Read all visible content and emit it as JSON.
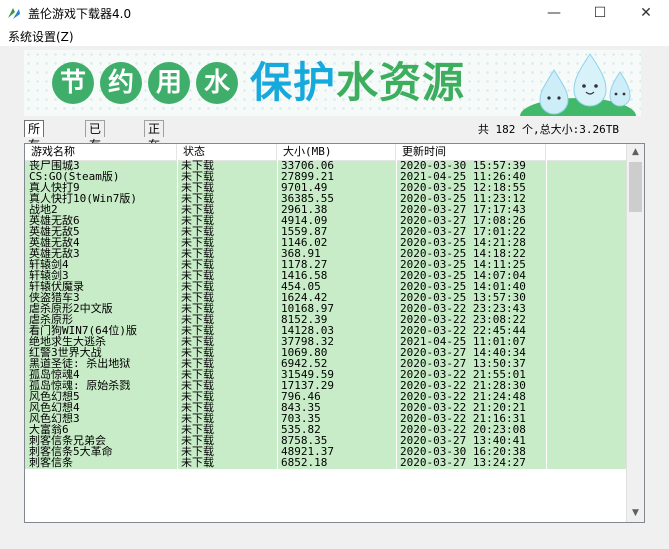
{
  "window": {
    "title": "盖伦游戏下载器4.0",
    "minimize": "—",
    "maximize": "☐",
    "close": "✕"
  },
  "menu": {
    "system_settings": "系统设置(Z)"
  },
  "banner": {
    "slogan_1": [
      "节",
      "约",
      "用",
      "水"
    ],
    "slogan_2a": "保护",
    "slogan_2b": "水资源"
  },
  "tabs": [
    "所有游戏",
    "已有游戏",
    "正在下载"
  ],
  "summary": "共 182 个,总大小:3.26TB",
  "columns": [
    "游戏名称",
    "状态",
    "大小(MB)",
    "更新时间"
  ],
  "rows": [
    [
      "丧尸围城3",
      "未下载",
      "33706.06",
      "2020-03-30 15:57:39"
    ],
    [
      "CS:GO(Steam版)",
      "未下载",
      "27899.21",
      "2021-04-25 11:26:40"
    ],
    [
      "真人快打9",
      "未下载",
      "9701.49",
      "2020-03-25 12:18:55"
    ],
    [
      "真人快打10(Win7版)",
      "未下载",
      "36385.55",
      "2020-03-25 11:23:12"
    ],
    [
      "战地2",
      "未下载",
      "2961.38",
      "2020-03-27 17:17:43"
    ],
    [
      "英雄无敌6",
      "未下载",
      "4914.09",
      "2020-03-27 17:08:26"
    ],
    [
      "英雄无敌5",
      "未下载",
      "1559.87",
      "2020-03-27 17:01:22"
    ],
    [
      "英雄无敌4",
      "未下载",
      "1146.02",
      "2020-03-25 14:21:28"
    ],
    [
      "英雄无敌3",
      "未下载",
      "368.91",
      "2020-03-25 14:18:22"
    ],
    [
      "轩辕剑4",
      "未下载",
      "1178.27",
      "2020-03-25 14:11:25"
    ],
    [
      "轩辕剑3",
      "未下载",
      "1416.58",
      "2020-03-25 14:07:04"
    ],
    [
      "轩辕伏魔录",
      "未下载",
      "454.05",
      "2020-03-25 14:01:40"
    ],
    [
      "侠盗猎车3",
      "未下载",
      "1624.42",
      "2020-03-25 13:57:30"
    ],
    [
      "虐杀原形2中文版",
      "未下载",
      "10168.97",
      "2020-03-22 23:23:43"
    ],
    [
      "虐杀原形",
      "未下载",
      "8152.39",
      "2020-03-22 23:08:22"
    ],
    [
      "看门狗WIN7(64位)版",
      "未下载",
      "14128.03",
      "2020-03-22 22:45:44"
    ],
    [
      "绝地求生大逃杀",
      "未下载",
      "37798.32",
      "2021-04-25 11:01:07"
    ],
    [
      "红警3世界大战",
      "未下载",
      "1069.80",
      "2020-03-27 14:40:34"
    ],
    [
      "黑道圣徒: 杀出地狱",
      "未下载",
      "6942.52",
      "2020-03-27 13:50:37"
    ],
    [
      "孤岛惊魂4",
      "未下载",
      "31549.59",
      "2020-03-22 21:55:01"
    ],
    [
      "孤岛惊魂: 原始杀戮",
      "未下载",
      "17137.29",
      "2020-03-22 21:28:30"
    ],
    [
      "风色幻想5",
      "未下载",
      "796.46",
      "2020-03-22 21:24:48"
    ],
    [
      "风色幻想4",
      "未下载",
      "843.35",
      "2020-03-22 21:20:21"
    ],
    [
      "风色幻想3",
      "未下载",
      "703.35",
      "2020-03-22 21:16:31"
    ],
    [
      "大富翁6",
      "未下载",
      "535.82",
      "2020-03-22 20:23:08"
    ],
    [
      "刺客信条兄弟会",
      "未下载",
      "8758.35",
      "2020-03-27 13:40:41"
    ],
    [
      "刺客信条5大革命",
      "未下载",
      "48921.37",
      "2020-03-30 16:20:38"
    ],
    [
      "刺客信条",
      "未下载",
      "6852.18",
      "2020-03-27 13:24:27"
    ]
  ]
}
